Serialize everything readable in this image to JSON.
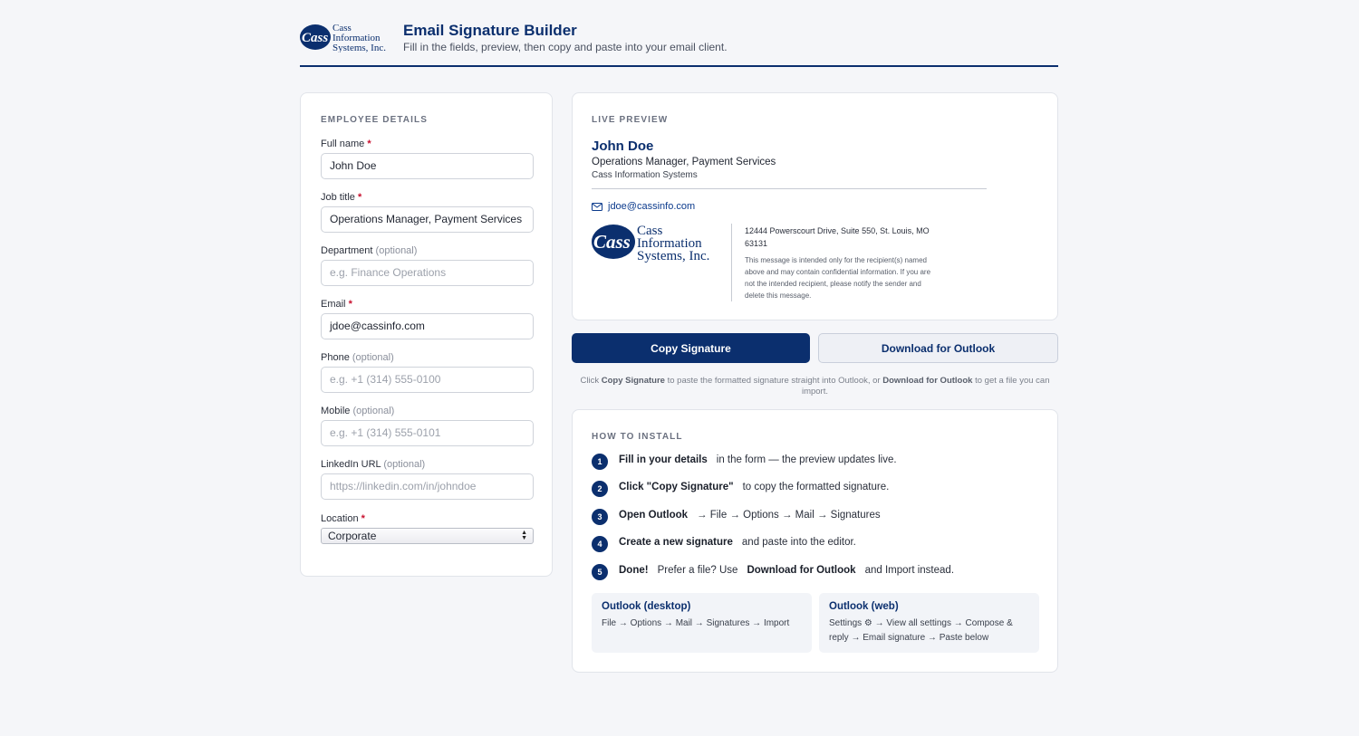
{
  "brand": {
    "logo_text": [
      "Cass",
      "Information",
      "Systems, Inc."
    ],
    "primary_color": "#0b2f6e",
    "required_color": "#c8102e"
  },
  "header": {
    "title": "Email Signature Builder",
    "subtitle": "Fill in the fields, preview, then copy and paste into your email client."
  },
  "form": {
    "section_title": "EMPLOYEE DETAILS",
    "fields": [
      {
        "label": "Full name",
        "required": "*",
        "optional": "",
        "value": "John Doe",
        "placeholder": ""
      },
      {
        "label": "Job title",
        "required": "*",
        "optional": "",
        "value": "Operations Manager, Payment Services",
        "placeholder": ""
      },
      {
        "label": "Department",
        "required": "",
        "optional": "(optional)",
        "value": "",
        "placeholder": "e.g. Finance Operations"
      },
      {
        "label": "Email",
        "required": "*",
        "optional": "",
        "value": "jdoe@cassinfo.com",
        "placeholder": ""
      },
      {
        "label": "Phone",
        "required": "",
        "optional": "(optional)",
        "value": "",
        "placeholder": "e.g. +1 (314) 555-0100"
      },
      {
        "label": "Mobile",
        "required": "",
        "optional": "(optional)",
        "value": "",
        "placeholder": "e.g. +1 (314) 555-0101"
      },
      {
        "label": "LinkedIn URL",
        "required": "",
        "optional": "(optional)",
        "value": "",
        "placeholder": "https://linkedin.com/in/johndoe"
      }
    ],
    "location": {
      "label": "Location",
      "required": "*",
      "selected": "Corporate"
    }
  },
  "preview": {
    "section_title": "LIVE PREVIEW",
    "name": "John Doe",
    "job_title": "Operations Manager, Payment Services",
    "company": "Cass Information Systems",
    "email": "jdoe@cassinfo.com",
    "address": "12444 Powerscourt Drive, Suite 550, St. Louis, MO 63131",
    "disclaimer": "This message is intended only for the recipient(s) named above and may contain confidential information. If you are not the intended recipient, please notify the sender and delete this message."
  },
  "actions": {
    "copy_label": "Copy Signature",
    "download_label": "Download for Outlook",
    "hint_pre": "Click ",
    "hint_copy": "Copy Signature",
    "hint_mid": " to paste the formatted signature straight into Outlook, or ",
    "hint_download": "Download for Outlook",
    "hint_post": " to get a file you can import."
  },
  "install": {
    "section_title": "HOW TO INSTALL",
    "steps": [
      {
        "num": "1",
        "bold": "Fill in your details",
        "text": "in the form — the preview updates live.",
        "bold2": "",
        "text2": ""
      },
      {
        "num": "2",
        "bold": "Click \"Copy Signature\"",
        "text": "to copy the formatted signature.",
        "bold2": "",
        "text2": ""
      },
      {
        "num": "3",
        "bold": "Open Outlook",
        "text": "→ File → Options → Mail → Signatures",
        "bold2": "",
        "text2": ""
      },
      {
        "num": "4",
        "bold": "Create a new signature",
        "text": "and paste into the editor.",
        "bold2": "",
        "text2": ""
      },
      {
        "num": "5",
        "bold": "Done!",
        "text": "Prefer a file? Use",
        "bold2": "Download for Outlook",
        "text2": "and Import instead."
      }
    ],
    "tips": [
      {
        "title": "Outlook (desktop)",
        "text": "File → Options → Mail → Signatures → Import"
      },
      {
        "title": "Outlook (web)",
        "text": "Settings ⚙ → View all settings → Compose & reply → Email signature → Paste below"
      }
    ]
  }
}
